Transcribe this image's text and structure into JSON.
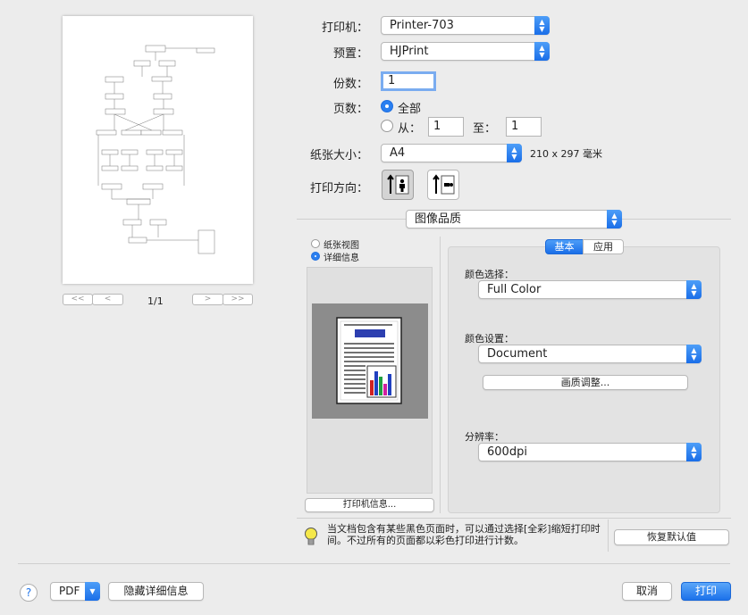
{
  "preview": {
    "page_indicator": "1/1",
    "nav": {
      "first": "<<",
      "prev": "<",
      "next": ">",
      "last": ">>"
    }
  },
  "settings": {
    "printer_label": "打印机：",
    "printer_value": "Printer-703",
    "preset_label": "预置：",
    "preset_value": "HJPrint",
    "copies_label": "份数：",
    "copies_value": "1",
    "pages_label": "页数：",
    "pages_all": "全部",
    "pages_from": "从：",
    "pages_from_value": "1",
    "pages_to": "至：",
    "pages_to_value": "1",
    "paper_label": "纸张大小：",
    "paper_value": "A4",
    "paper_dims": "210 x 297 毫米",
    "orientation_label": "打印方向："
  },
  "section": {
    "value": "图像品质"
  },
  "left_panel": {
    "paper_view": "纸张视图",
    "detail_info": "详细信息",
    "printer_info_button": "打印机信息..."
  },
  "right_panel": {
    "tab_basic": "基本",
    "tab_apply": "应用",
    "color_select_label": "颜色选择：",
    "color_select_value": "Full Color",
    "color_setting_label": "颜色设置：",
    "color_setting_value": "Document",
    "quality_adjust_button": "画质调整...",
    "resolution_label": "分辨率：",
    "resolution_value": "600dpi"
  },
  "hint": {
    "text_line1": "当文档包含有某些黑色页面时，可以通过选择[全彩]缩短打印时",
    "text_line2": "间。不过所有的页面都以彩色打印进行计数。",
    "restore_button": "恢复默认值"
  },
  "footer": {
    "help": "?",
    "pdf": "PDF",
    "hide_details": "隐藏详细信息",
    "cancel": "取消",
    "print": "打印"
  },
  "colors": {
    "accent": "#1c72ea",
    "window_bg": "#ececec",
    "panel_bg": "#e3e3e3"
  }
}
